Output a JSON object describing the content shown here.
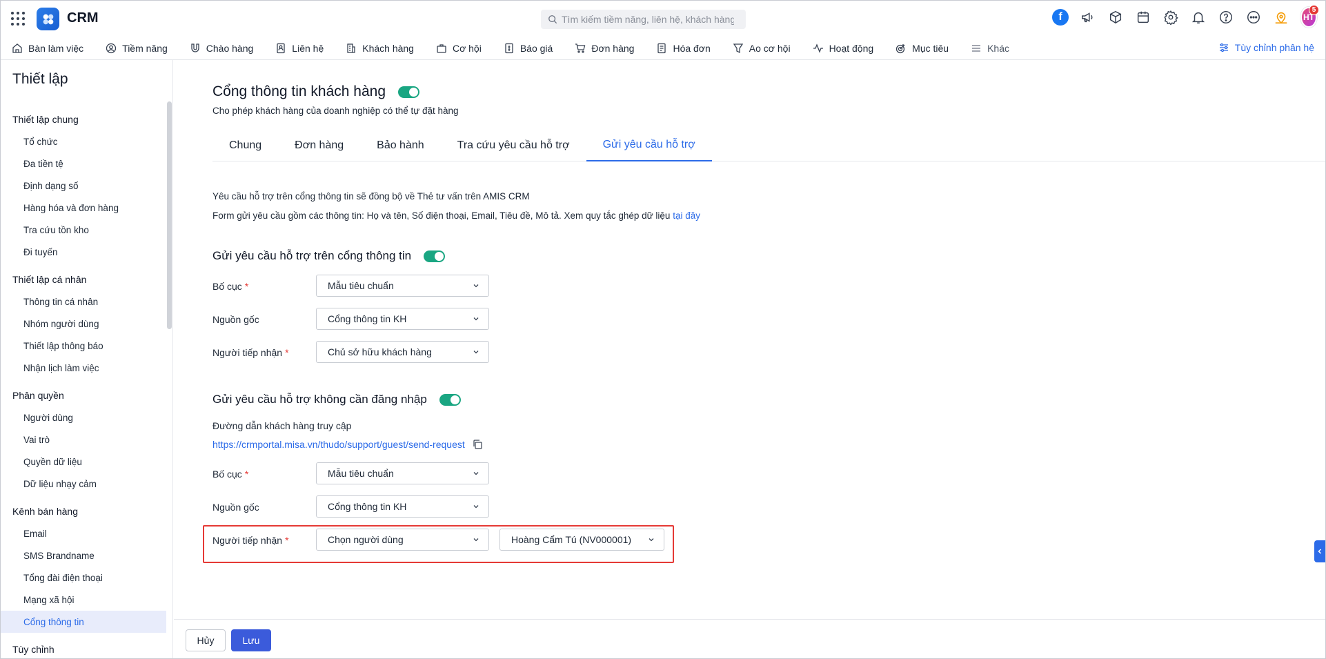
{
  "app": {
    "title": "CRM"
  },
  "search": {
    "placeholder": "Tìm kiếm tiềm năng, liên hệ, khách hàng"
  },
  "user": {
    "initials": "HT",
    "notifications": "5"
  },
  "nav": {
    "items": [
      {
        "label": "Bàn làm việc",
        "icon": "home-icon"
      },
      {
        "label": "Tiềm năng",
        "icon": "user-circle-icon"
      },
      {
        "label": "Chào hàng",
        "icon": "magnet-icon"
      },
      {
        "label": "Liên hệ",
        "icon": "contact-card-icon"
      },
      {
        "label": "Khách hàng",
        "icon": "building-icon"
      },
      {
        "label": "Cơ hội",
        "icon": "briefcase-icon"
      },
      {
        "label": "Báo giá",
        "icon": "quote-doc-icon"
      },
      {
        "label": "Đơn hàng",
        "icon": "cart-icon"
      },
      {
        "label": "Hóa đơn",
        "icon": "invoice-icon"
      },
      {
        "label": "Ao cơ hội",
        "icon": "funnel-icon"
      },
      {
        "label": "Hoạt động",
        "icon": "activity-icon"
      },
      {
        "label": "Mục tiêu",
        "icon": "target-icon"
      },
      {
        "label": "Khác",
        "icon": "menu-icon"
      }
    ],
    "customize_label": "Tùy chỉnh phân hệ"
  },
  "sidebar": {
    "title": "Thiết lập",
    "groups": [
      {
        "label": "Thiết lập chung",
        "items": [
          "Tổ chức",
          "Đa tiền tệ",
          "Định dạng số",
          "Hàng hóa và đơn hàng",
          "Tra cứu tồn kho",
          "Đi tuyến"
        ]
      },
      {
        "label": "Thiết lập cá nhân",
        "items": [
          "Thông tin cá nhân",
          "Nhóm người dùng",
          "Thiết lập thông báo",
          "Nhận lịch làm việc"
        ]
      },
      {
        "label": "Phân quyền",
        "items": [
          "Người dùng",
          "Vai trò",
          "Quyền dữ liệu",
          "Dữ liệu nhạy cảm"
        ]
      },
      {
        "label": "Kênh bán hàng",
        "items": [
          "Email",
          "SMS Brandname",
          "Tổng đài điện thoại",
          "Mạng xã hội",
          "Cổng thông tin"
        ]
      },
      {
        "label": "Tùy chỉnh",
        "items": []
      }
    ],
    "active_item": "Cổng thông tin"
  },
  "page": {
    "title": "Cổng thông tin khách hàng",
    "subtitle": "Cho phép khách hàng của doanh nghiệp có thể tự đặt hàng",
    "enabled": true,
    "tabs": [
      "Chung",
      "Đơn hàng",
      "Bảo hành",
      "Tra cứu yêu cầu hỗ trợ",
      "Gửi yêu cầu hỗ trợ"
    ],
    "active_tab": "Gửi yêu cầu hỗ trợ",
    "info_line1": "Yêu cầu hỗ trợ trên cổng thông tin sẽ đồng bộ về Thẻ tư vấn trên AMIS CRM",
    "info_line2": "Form gửi yêu cầu gồm các thông tin: Họ và tên, Số điện thoại, Email, Tiêu đề, Mô tả. Xem quy tắc ghép dữ liệu",
    "info_link": "tại đây"
  },
  "section1": {
    "title": "Gửi yêu cầu hỗ trợ trên cổng thông tin",
    "enabled": true,
    "layout_label": "Bố cục",
    "layout_value": "Mẫu tiêu chuẩn",
    "source_label": "Nguồn gốc",
    "source_value": "Cổng thông tin KH",
    "receiver_label": "Người tiếp nhận",
    "receiver_value": "Chủ sở hữu khách hàng"
  },
  "section2": {
    "title": "Gửi yêu cầu hỗ trợ không cần đăng nhập",
    "enabled": true,
    "link_label": "Đường dẫn khách hàng truy cập",
    "link_url": "https://crmportal.misa.vn/thudo/support/guest/send-request",
    "layout_label": "Bố cục",
    "layout_value": "Mẫu tiêu chuẩn",
    "source_label": "Nguồn gốc",
    "source_value": "Cổng thông tin KH",
    "receiver_label": "Người tiếp nhận",
    "receiver_value": "Chọn người dùng",
    "receiver_user_value": "Hoàng Cẩm Tú (NV000001)"
  },
  "footer": {
    "cancel_label": "Hủy",
    "save_label": "Lưu"
  },
  "colors": {
    "accent": "#2c6be8",
    "toggle_on": "#1aa682",
    "save_button": "#3b5bdb",
    "highlight": "#e53935",
    "required": "#e53935"
  }
}
